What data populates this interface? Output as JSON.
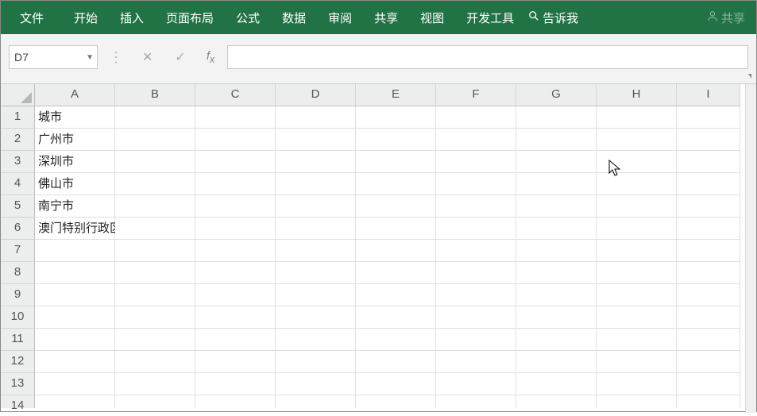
{
  "ribbon": {
    "tabs": [
      "文件",
      "开始",
      "插入",
      "页面布局",
      "公式",
      "数据",
      "审阅",
      "共享",
      "视图",
      "开发工具"
    ],
    "searchPlaceholder": "告诉我",
    "shareLabel": "共享"
  },
  "formulaBar": {
    "nameBox": "D7",
    "formula": ""
  },
  "columns": [
    "A",
    "B",
    "C",
    "D",
    "E",
    "F",
    "G",
    "H",
    "I"
  ],
  "rows": [
    "1",
    "2",
    "3",
    "4",
    "5",
    "6",
    "7",
    "8",
    "9",
    "10",
    "11",
    "12",
    "13",
    "14"
  ],
  "cells": {
    "A1": "城市",
    "A2": "广州市",
    "A3": "深圳市",
    "A4": "佛山市",
    "A5": "南宁市",
    "A6": "澳门特别行政区"
  }
}
